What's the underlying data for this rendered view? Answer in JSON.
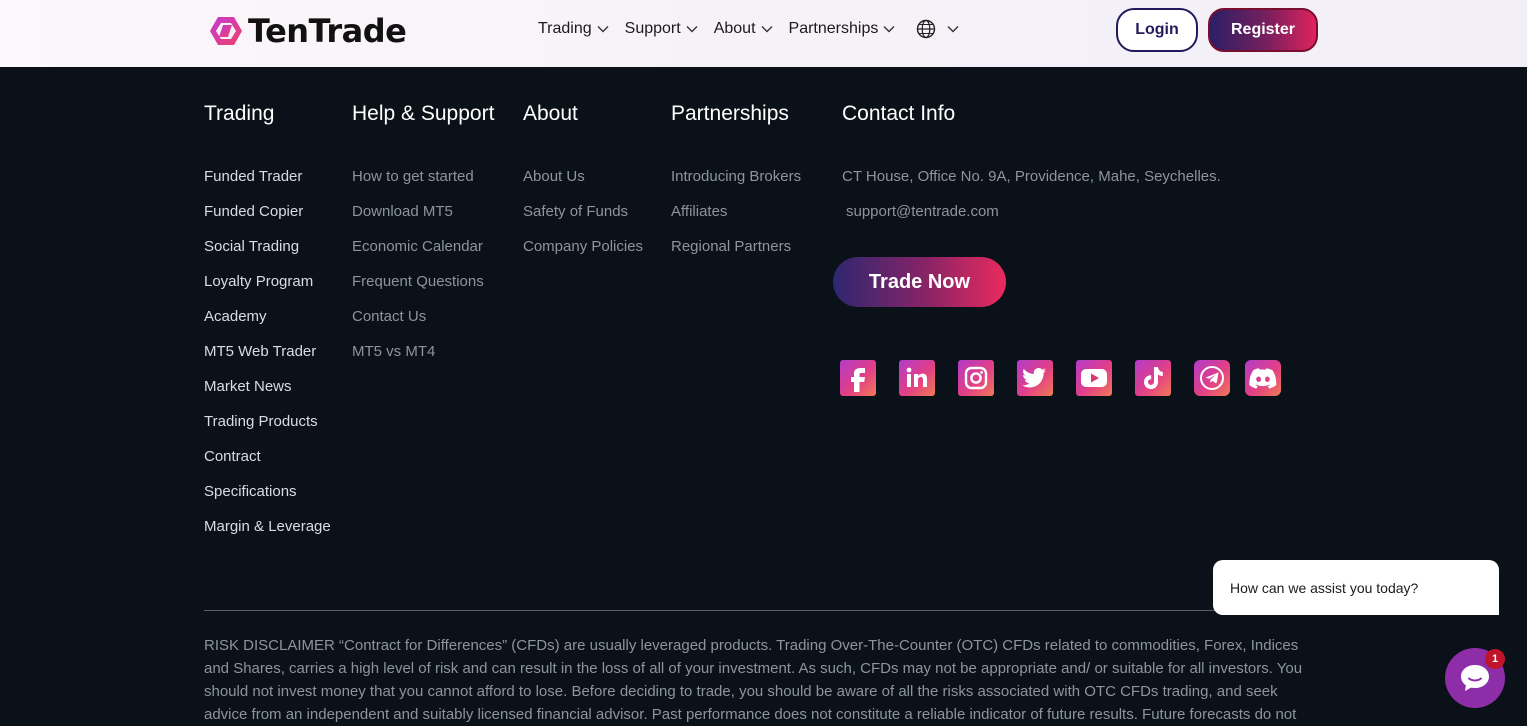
{
  "header": {
    "brand": "TenTrade",
    "nav": [
      {
        "label": "Trading"
      },
      {
        "label": "Support"
      },
      {
        "label": "About"
      },
      {
        "label": "Partnerships"
      }
    ],
    "login_label": "Login",
    "register_label": "Register"
  },
  "footer": {
    "columns": [
      {
        "title": "Trading",
        "links": [
          "Funded Trader",
          "Funded Copier",
          "Social Trading",
          "Loyalty Program",
          "Academy",
          "MT5 Web Trader",
          "Market News",
          "Trading Products",
          "Contract",
          "Specifications",
          "Margin & Leverage"
        ]
      },
      {
        "title": "Help & Support",
        "links": [
          "How to get started",
          "Download MT5",
          "Economic Calendar",
          "Frequent Questions",
          "Contact Us",
          "MT5 vs MT4"
        ]
      },
      {
        "title": "About",
        "links": [
          "About Us",
          "Safety of Funds",
          "Company Policies"
        ]
      },
      {
        "title": "Partnerships",
        "links": [
          "Introducing Brokers",
          "Affiliates",
          "Regional Partners"
        ]
      }
    ],
    "contact": {
      "title": "Contact Info",
      "address": "CT House, Office No. 9A, Providence, Mahe, Seychelles.",
      "email": "support@tentrade.com",
      "cta_label": "Trade Now"
    },
    "social_icons": [
      "facebook-icon",
      "linkedin-icon",
      "instagram-icon",
      "twitter-icon",
      "youtube-icon",
      "tiktok-icon",
      "telegram-icon",
      "discord-icon"
    ],
    "disclaimer": "RISK DISCLAIMER “Contract for Differences” (CFDs) are usually leveraged products. Trading Over-The-Counter (OTC) CFDs related to commodities, Forex, Indices and Shares, carries a high level of risk and can result in the loss of all of your investment. As such, CFDs may not be appropriate and/ or suitable for all investors. You should not invest money that you cannot afford to lose. Before deciding to trade, you should be aware of all the risks associated with OTC CFDs trading, and seek advice from an independent and suitably licensed financial advisor. Past performance does not constitute a reliable indicator of future results. Future forecasts do not constitute a reliable"
  },
  "chat": {
    "prompt": "How can we assist you today?",
    "badge_count": "1"
  },
  "colors": {
    "footer_bg": "#0b1118",
    "accent_start": "#2a1f66",
    "accent_end": "#e0235c",
    "chat_purple": "#8e2da8"
  }
}
